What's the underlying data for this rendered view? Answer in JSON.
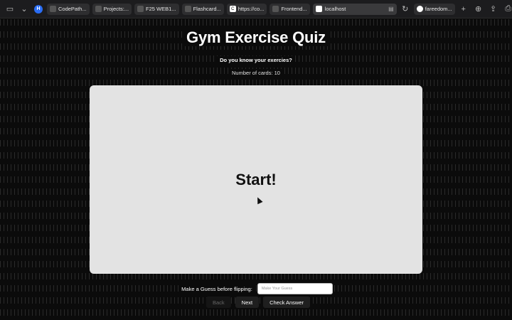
{
  "browser": {
    "tabs": [
      {
        "label": "CodePath..."
      },
      {
        "label": "Projects:..."
      },
      {
        "label": "F25 WEB1..."
      },
      {
        "label": "Flashcard..."
      },
      {
        "label": "https://co..."
      },
      {
        "label": "Frontend..."
      }
    ],
    "address": "localhost",
    "profile_tab": "fareedom..."
  },
  "header": {
    "title": "Gym Exercise Quiz",
    "subtitle": "Do you know your exercies?",
    "count_text": "Number of cards: 10"
  },
  "card": {
    "text": "Start!"
  },
  "guess": {
    "label": "Make a Guess before flipping:",
    "placeholder": "Make Your Guess",
    "value": ""
  },
  "buttons": {
    "back": "Back",
    "next": "Next",
    "check": "Check Answer"
  },
  "colors": {
    "background": "#0b0b0b",
    "card": "#e3e3e3"
  }
}
